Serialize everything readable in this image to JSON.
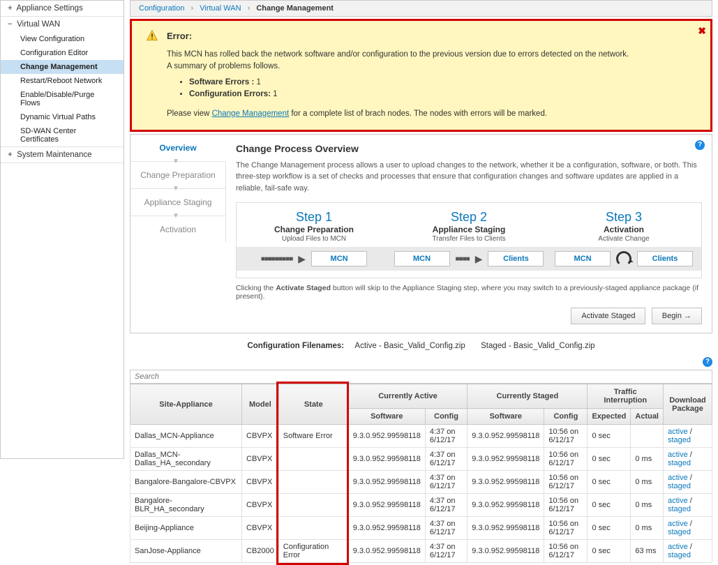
{
  "sidebar": {
    "sections": [
      {
        "label": "Appliance Settings",
        "symbol": "+",
        "open": false,
        "items": []
      },
      {
        "label": "Virtual WAN",
        "symbol": "−",
        "open": true,
        "items": [
          {
            "label": "View Configuration"
          },
          {
            "label": "Configuration Editor"
          },
          {
            "label": "Change Management",
            "active": true
          },
          {
            "label": "Restart/Reboot Network"
          },
          {
            "label": "Enable/Disable/Purge Flows"
          },
          {
            "label": "Dynamic Virtual Paths"
          },
          {
            "label": "SD-WAN Center Certificates"
          }
        ]
      },
      {
        "label": "System Maintenance",
        "symbol": "+",
        "open": false,
        "items": []
      }
    ]
  },
  "breadcrumb": {
    "items": [
      "Configuration",
      "Virtual WAN"
    ],
    "current": "Change Management"
  },
  "alert": {
    "heading": "Error:",
    "body": "This MCN has rolled back the network software and/or configuration to the previous version due to errors detected on the network.\nA summary of problems follows.",
    "bullets": [
      {
        "label": "Software Errors :",
        "count": "1"
      },
      {
        "label": "Configuration Errors:",
        "count": "1"
      }
    ],
    "footer_pre": "Please view ",
    "footer_link": "Change Management",
    "footer_post": " for a complete list of brach nodes. The nodes with errors will be marked."
  },
  "overview": {
    "tabs": [
      "Overview",
      "Change Preparation",
      "Appliance Staging",
      "Activation"
    ],
    "title": "Change Process Overview",
    "desc": "The Change Management process allows a user to upload changes to the network, whether it be a configuration, software, or both. This three-step workflow is a set of checks and processes that ensure that configuration changes and software updates are applied in a reliable, fail-safe way.",
    "steps": [
      {
        "title": "Step 1",
        "sub": "Change Preparation",
        "tiny": "Upload Files to MCN"
      },
      {
        "title": "Step 2",
        "sub": "Appliance Staging",
        "tiny": "Transfer Files to Clients"
      },
      {
        "title": "Step 3",
        "sub": "Activation",
        "tiny": "Activate Change"
      }
    ],
    "btns": {
      "mcn": "MCN",
      "clients": "Clients"
    },
    "note_pre": "Clicking the ",
    "note_b": "Activate Staged",
    "note_post": " button will skip to the Appliance Staging step, where you may switch to a previously-staged appliance package (if present).",
    "action_activate": "Activate Staged",
    "action_begin": "Begin →"
  },
  "config_line": {
    "label": "Configuration Filenames:",
    "active_label": "Active - ",
    "active_file": "Basic_Valid_Config.zip",
    "staged_label": "Staged - ",
    "staged_file": "Basic_Valid_Config.zip"
  },
  "search_placeholder": "Search",
  "table": {
    "headers": {
      "site": "Site-Appliance",
      "model": "Model",
      "state": "State",
      "curr_act": "Currently Active",
      "curr_stg": "Currently Staged",
      "traffic": "Traffic Interruption",
      "download": "Download Package",
      "software": "Software",
      "config": "Config",
      "expected": "Expected",
      "actual": "Actual"
    },
    "link_active": "active",
    "link_staged": "staged",
    "rows": [
      {
        "site": "Dallas_MCN-Appliance",
        "model": "CBVPX",
        "state": "Software Error",
        "asw": "9.3.0.952.99598118",
        "acfg": "4:37 on 6/12/17",
        "ssw": "9.3.0.952.99598118",
        "scfg": "10:56 on 6/12/17",
        "exp": "0 sec",
        "act": ""
      },
      {
        "site": "Dallas_MCN-Dallas_HA_secondary",
        "model": "CBVPX",
        "state": "",
        "asw": "9.3.0.952.99598118",
        "acfg": "4:37 on 6/12/17",
        "ssw": "9.3.0.952.99598118",
        "scfg": "10:56 on 6/12/17",
        "exp": "0 sec",
        "act": "0 ms"
      },
      {
        "site": "Bangalore-Bangalore-CBVPX",
        "model": "CBVPX",
        "state": "",
        "asw": "9.3.0.952.99598118",
        "acfg": "4:37 on 6/12/17",
        "ssw": "9.3.0.952.99598118",
        "scfg": "10:56 on 6/12/17",
        "exp": "0 sec",
        "act": "0 ms"
      },
      {
        "site": "Bangalore-BLR_HA_secondary",
        "model": "CBVPX",
        "state": "",
        "asw": "9.3.0.952.99598118",
        "acfg": "4:37 on 6/12/17",
        "ssw": "9.3.0.952.99598118",
        "scfg": "10:56 on 6/12/17",
        "exp": "0 sec",
        "act": "0 ms"
      },
      {
        "site": "Beijing-Appliance",
        "model": "CBVPX",
        "state": "",
        "asw": "9.3.0.952.99598118",
        "acfg": "4:37 on 6/12/17",
        "ssw": "9.3.0.952.99598118",
        "scfg": "10:56 on 6/12/17",
        "exp": "0 sec",
        "act": "0 ms"
      },
      {
        "site": "SanJose-Appliance",
        "model": "CB2000",
        "state": "Configuration Error",
        "asw": "9.3.0.952.99598118",
        "acfg": "4:37 on 6/12/17",
        "ssw": "9.3.0.952.99598118",
        "scfg": "10:56 on 6/12/17",
        "exp": "0 sec",
        "act": "63 ms"
      }
    ]
  }
}
